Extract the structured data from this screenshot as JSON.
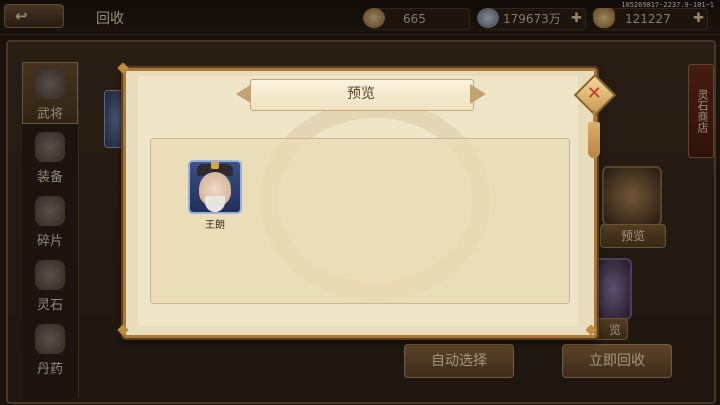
{
  "topbar": {
    "back_icon": "back-arrow-icon",
    "title": "回收",
    "resources": [
      {
        "icon": "treasure-icon",
        "value": "665",
        "has_plus": false
      },
      {
        "icon": "silver-coin-icon",
        "value": "179673万",
        "has_plus": true
      },
      {
        "icon": "gold-ingot-icon",
        "value": "121227",
        "has_plus": true
      }
    ],
    "plus": "✚",
    "version": "105269817-2237.9-101~1"
  },
  "left_tabs": [
    {
      "label": "武将",
      "icon": "general-icon",
      "active": true
    },
    {
      "label": "装备",
      "icon": "equipment-icon",
      "active": false
    },
    {
      "label": "碎片",
      "icon": "fragment-icon",
      "active": false
    },
    {
      "label": "灵石",
      "icon": "spirit-stone-icon",
      "active": false
    },
    {
      "label": "丹药",
      "icon": "elixir-icon",
      "active": false
    }
  ],
  "side_shop": {
    "label": "灵石商店"
  },
  "background_buttons": {
    "preview": "预览",
    "preview2": "览",
    "auto_select": "自动选择",
    "recycle_now": "立即回收"
  },
  "modal": {
    "title": "预览",
    "close_icon": "close-icon",
    "heroes": [
      {
        "name": "王朗",
        "portrait": "hero-portrait-icon"
      }
    ]
  },
  "colors": {
    "modal_bg": "#e8dcbc",
    "frame_gold": "#a87839",
    "close_x": "#c0391f"
  }
}
